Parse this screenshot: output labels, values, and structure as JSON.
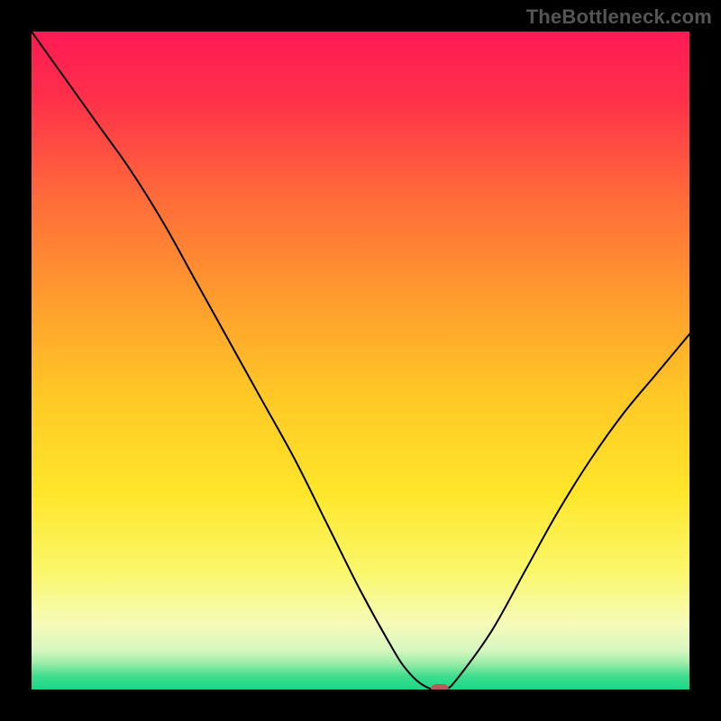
{
  "watermark": "TheBottleneck.com",
  "colors": {
    "marker": "#b85a5a",
    "curve": "#000000",
    "frame_bg": "#000000"
  },
  "gradient_stops": [
    {
      "offset": 0,
      "color": "#ff1a55"
    },
    {
      "offset": 10,
      "color": "#ff2f4a"
    },
    {
      "offset": 25,
      "color": "#ff6a3a"
    },
    {
      "offset": 40,
      "color": "#ff9a2e"
    },
    {
      "offset": 55,
      "color": "#ffc726"
    },
    {
      "offset": 70,
      "color": "#ffe62a"
    },
    {
      "offset": 82,
      "color": "#faf76a"
    },
    {
      "offset": 90,
      "color": "#f6fbb8"
    },
    {
      "offset": 94,
      "color": "#d7f7c0"
    },
    {
      "offset": 96,
      "color": "#9ceca8"
    },
    {
      "offset": 98,
      "color": "#3fdc8e"
    },
    {
      "offset": 100,
      "color": "#17d987"
    }
  ],
  "chart_data": {
    "type": "line",
    "title": "",
    "xlabel": "",
    "ylabel": "",
    "xlim": [
      0,
      100
    ],
    "ylim": [
      0,
      100
    ],
    "x": [
      0,
      5,
      10,
      15,
      20,
      25,
      30,
      35,
      40,
      45,
      50,
      55,
      57,
      59,
      61,
      63,
      65,
      70,
      75,
      80,
      85,
      90,
      95,
      100
    ],
    "values": [
      100,
      93,
      86,
      79,
      71,
      62,
      53,
      44,
      35,
      25,
      15,
      6,
      3,
      1,
      0,
      0,
      2,
      9,
      18,
      27,
      35,
      42,
      48,
      54
    ],
    "marker": {
      "x": 62,
      "y": 0
    },
    "grid": false,
    "legend": false
  }
}
